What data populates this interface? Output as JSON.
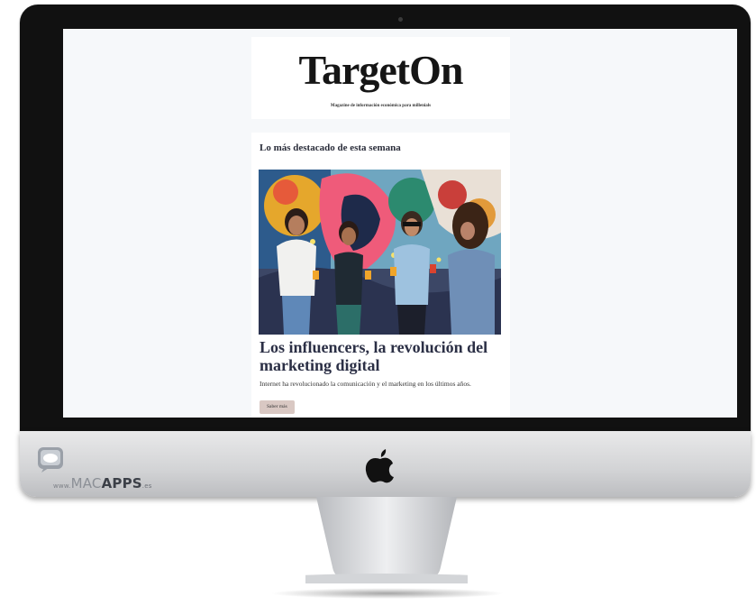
{
  "newsletter": {
    "brand": "TargetOn",
    "tagline": "Magazine de información económica para millenials",
    "section_heading": "Lo más destacado de esta semana",
    "article": {
      "title": "Los influencers, la revolución del marketing digital",
      "summary": "Internet ha revolucionado la comunicación y el marketing en los últimos años.",
      "cta_label": "Saber más"
    }
  },
  "device": {
    "logo": "apple-logo-icon"
  },
  "watermark": {
    "prefix": "www.",
    "mac": "MAC",
    "apps": "APPS",
    "tld": ".es"
  },
  "colors": {
    "screen_bg": "#f6f8fa",
    "heading": "#2b2f45",
    "button_bg": "#d9c8c3",
    "bezel": "#111111",
    "chin": "#d2d3d5"
  }
}
